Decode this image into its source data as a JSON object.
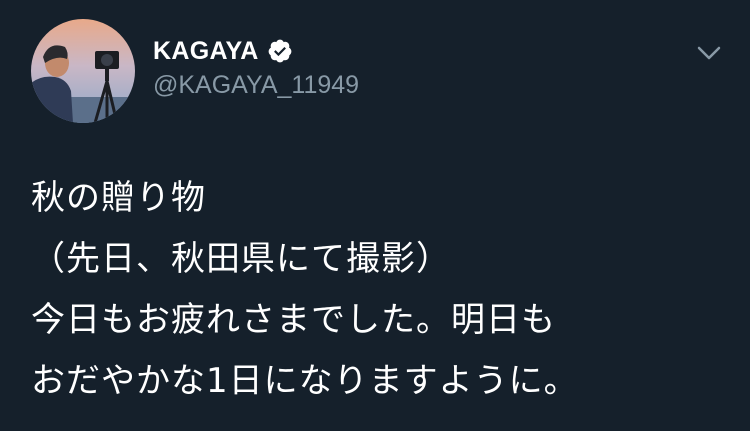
{
  "tweet": {
    "author": {
      "display_name": "KAGAYA",
      "handle": "@KAGAYA_11949",
      "verified": true
    },
    "text_lines": [
      "秋の贈り物",
      "（先日、秋田県にて撮影）",
      "今日もお疲れさまでした。明日も",
      "おだやかな1日になりますように。"
    ]
  },
  "icons": {
    "verified": "verified-badge-icon",
    "menu": "chevron-down-icon"
  },
  "colors": {
    "background": "#15202b",
    "primary_text": "#ffffff",
    "secondary_text": "#8899a6"
  }
}
